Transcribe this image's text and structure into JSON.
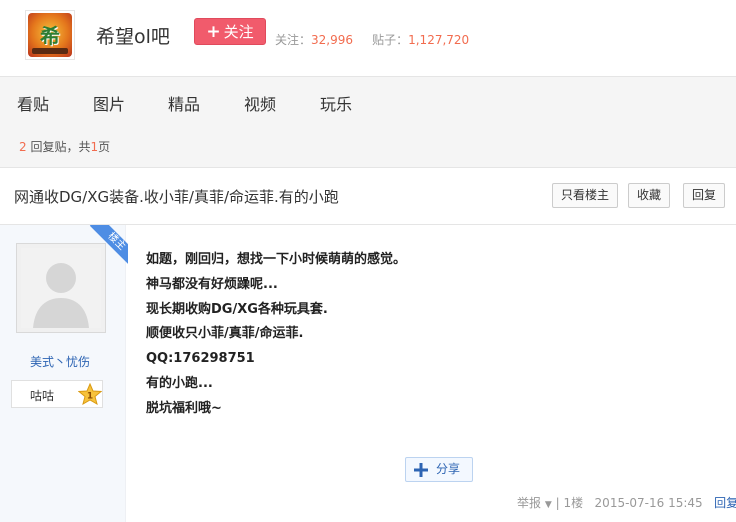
{
  "forum": {
    "name": "希望ol吧",
    "follow_label": "关注",
    "follow_plus": "+",
    "followers_label": "关注：",
    "followers": "32,996",
    "posts_label": "贴子：",
    "posts": "1,127,720"
  },
  "nav": {
    "items": [
      "看贴",
      "图片",
      "精品",
      "视频",
      "玩乐"
    ]
  },
  "reply_count": {
    "count": "2",
    "count_suffix": " 回复贴，共",
    "pages": "1",
    "pages_suffix": "页"
  },
  "thread": {
    "title": "网通收DG/XG装备.收小菲/真菲/命运菲.有的小跑",
    "buttons": {
      "only_op": "只看楼主",
      "favorite": "收藏",
      "reply": "回复"
    }
  },
  "post": {
    "badge": "楼主",
    "username": "美式丶忧伤",
    "level_name": "咕咕",
    "level": "1",
    "lines": [
      "如题，刚回归，想找一下小时候萌萌的感觉。",
      "神马都没有好烦躁呢...",
      "现长期收购DG/XG各种玩具套.",
      "顺便收只小菲/真菲/命运菲.",
      "QQ:176298751",
      "有的小跑...",
      "脱坑福利哦~"
    ],
    "share_label": "分享",
    "meta": {
      "report": "举报",
      "floor": "1楼",
      "time": "2015-07-16 15:45",
      "reply": "回复"
    }
  },
  "colors": {
    "accent_red": "#f15b6c",
    "link_blue": "#2d64b3",
    "highlight_orange": "#f26c4f",
    "badge_blue": "#4e8de4"
  }
}
